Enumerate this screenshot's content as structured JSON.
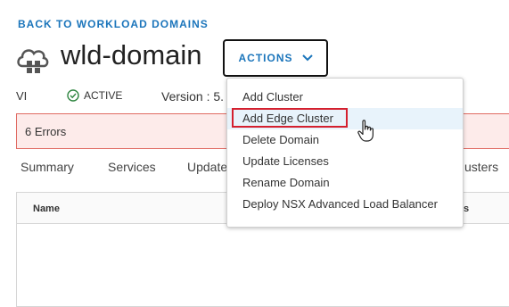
{
  "back_link": "BACK TO WORKLOAD DOMAINS",
  "domain": {
    "title": "wld-domain",
    "icon": "cloud-cluster-icon"
  },
  "actions": {
    "label": "ACTIONS",
    "icon": "chevron-down-icon"
  },
  "meta": {
    "type": "VI",
    "status": "ACTIVE",
    "status_icon": "check-circle-icon",
    "version": "Version : 5."
  },
  "alert": {
    "text": "6 Errors"
  },
  "tabs": [
    {
      "label": "Summary"
    },
    {
      "label": "Services"
    },
    {
      "label": "Update"
    },
    {
      "label": "usters"
    }
  ],
  "table": {
    "columns": [
      "Name",
      "s"
    ]
  },
  "menu": {
    "items": [
      {
        "label": "Add Cluster"
      },
      {
        "label": "Add Edge Cluster"
      },
      {
        "label": "Delete Domain"
      },
      {
        "label": "Update Licenses"
      },
      {
        "label": "Rename Domain"
      },
      {
        "label": "Deploy NSX Advanced Load Balancer"
      }
    ]
  },
  "colors": {
    "accent": "#1b75bb",
    "error_border": "#e06a62",
    "error_bg": "#fdebea",
    "highlight": "#d4202f",
    "success": "#2e8540"
  }
}
